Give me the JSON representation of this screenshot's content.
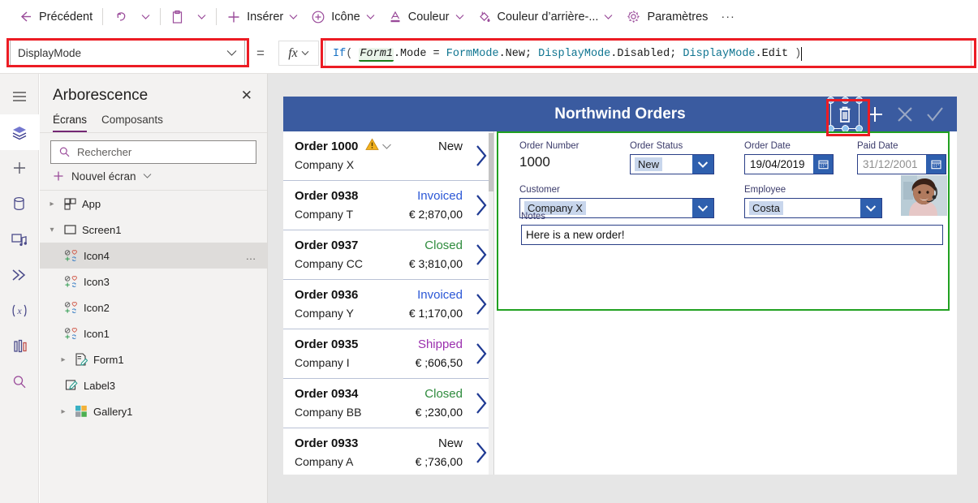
{
  "toolbar": {
    "back": {
      "label": "Précédent",
      "icon": "arrow-left-icon"
    },
    "undo": {
      "icon": "undo-icon"
    },
    "undo_caret": {
      "icon": "chevron-down-icon"
    },
    "paste": {
      "icon": "clipboard-icon"
    },
    "paste_caret": {
      "icon": "chevron-down-icon"
    },
    "insert": {
      "label": "Insérer",
      "icon": "plus-icon"
    },
    "icon_menu": {
      "label": "Icône",
      "icon": "circle-plus-icon"
    },
    "color": {
      "label": "Couleur",
      "icon": "font-color-icon"
    },
    "fill": {
      "label": "Couleur d’arrière-...",
      "icon": "fill-bucket-icon"
    },
    "settings": {
      "label": "Paramètres",
      "icon": "gear-icon"
    },
    "overflow": {
      "label": "···"
    }
  },
  "property_bar": {
    "selected_property": "DisplayMode",
    "equals": "=",
    "fx_label": "fx",
    "formula_tokens": [
      {
        "t": "If",
        "k": "fn"
      },
      {
        "t": "(",
        "k": "paren"
      },
      {
        "t": " ",
        "k": "plain"
      },
      {
        "t": "Form1",
        "k": "idbox"
      },
      {
        "t": ".Mode = ",
        "k": "plain"
      },
      {
        "t": "FormMode",
        "k": "enum"
      },
      {
        "t": ".New; ",
        "k": "plain"
      },
      {
        "t": "DisplayMode",
        "k": "enum"
      },
      {
        "t": ".Disabled; ",
        "k": "plain"
      },
      {
        "t": "DisplayMode",
        "k": "enum"
      },
      {
        "t": ".Edit ",
        "k": "plain"
      },
      {
        "t": ")",
        "k": "paren"
      }
    ],
    "formula_text": "If( Form1.Mode = FormMode.New; DisplayMode.Disabled; DisplayMode.Edit )"
  },
  "rail": {
    "items": [
      {
        "name": "hamburger-menu-icon",
        "active": false
      },
      {
        "name": "tree-view-icon",
        "active": true
      },
      {
        "name": "insert-icon",
        "active": false
      },
      {
        "name": "data-icon",
        "active": false
      },
      {
        "name": "media-icon",
        "active": false
      },
      {
        "name": "power-automate-icon",
        "active": false
      },
      {
        "name": "variables-icon",
        "active": false
      },
      {
        "name": "app-checker-icon",
        "active": false
      },
      {
        "name": "search-icon",
        "active": false
      }
    ]
  },
  "tree_panel": {
    "title": "Arborescence",
    "close_label": "✕",
    "tabs": [
      {
        "label": "Écrans",
        "selected": true
      },
      {
        "label": "Composants",
        "selected": false
      }
    ],
    "search_placeholder": "Rechercher",
    "new_screen_label": "Nouvel écran",
    "nodes": [
      {
        "label": "App",
        "icon": "app-icon",
        "indent": 1,
        "twisty": "collapsed",
        "selected": false,
        "dots": false
      },
      {
        "label": "Screen1",
        "icon": "screen-icon",
        "indent": 1,
        "twisty": "expanded",
        "selected": false,
        "dots": false
      },
      {
        "label": "Icon4",
        "icon": "icon-control-icon",
        "indent": 2,
        "twisty": "none",
        "selected": true,
        "dots": true
      },
      {
        "label": "Icon3",
        "icon": "icon-control-icon",
        "indent": 2,
        "twisty": "none",
        "selected": false,
        "dots": false
      },
      {
        "label": "Icon2",
        "icon": "icon-control-icon",
        "indent": 2,
        "twisty": "none",
        "selected": false,
        "dots": false
      },
      {
        "label": "Icon1",
        "icon": "icon-control-icon",
        "indent": 2,
        "twisty": "none",
        "selected": false,
        "dots": false
      },
      {
        "label": "Form1",
        "icon": "form-icon",
        "indent": 1,
        "twisty": "collapsed",
        "selected": false,
        "dots": false
      },
      {
        "label": "Label3",
        "icon": "label-icon",
        "indent": 2,
        "twisty": "none",
        "selected": false,
        "dots": false
      },
      {
        "label": "Gallery1",
        "icon": "gallery-icon",
        "indent": 1,
        "twisty": "collapsed",
        "selected": false,
        "dots": false
      }
    ]
  },
  "app_preview": {
    "header": {
      "title": "Northwind Orders",
      "bg_color": "#3a5ba0",
      "icons": [
        {
          "name": "trash-icon",
          "state": "selected"
        },
        {
          "name": "plus-icon",
          "state": "enabled"
        },
        {
          "name": "cancel-x-icon",
          "state": "disabled"
        },
        {
          "name": "check-icon",
          "state": "disabled"
        }
      ]
    },
    "gallery": {
      "rows": [
        {
          "order": "Order 1000",
          "company": "Company X",
          "status": "New",
          "status_color": "#1a1a1a",
          "amount": "",
          "warning": true
        },
        {
          "order": "Order 0938",
          "company": "Company T",
          "status": "Invoiced",
          "status_color": "#2b57d6",
          "amount": "€ 2;870,00",
          "warning": false
        },
        {
          "order": "Order 0937",
          "company": "Company CC",
          "status": "Closed",
          "status_color": "#2e8b3d",
          "amount": "€ 3;810,00",
          "warning": false
        },
        {
          "order": "Order 0936",
          "company": "Company Y",
          "status": "Invoiced",
          "status_color": "#2b57d6",
          "amount": "€ 1;170,00",
          "warning": false
        },
        {
          "order": "Order 0935",
          "company": "Company I",
          "status": "Shipped",
          "status_color": "#9b2fae",
          "amount": "€ ;606,50",
          "warning": false
        },
        {
          "order": "Order 0934",
          "company": "Company BB",
          "status": "Closed",
          "status_color": "#2e8b3d",
          "amount": "€ ;230,00",
          "warning": false
        },
        {
          "order": "Order 0933",
          "company": "Company A",
          "status": "New",
          "status_color": "#1a1a1a",
          "amount": "€ ;736,00",
          "warning": false
        }
      ]
    },
    "form": {
      "fields": {
        "order_number": {
          "label": "Order Number",
          "value": "1000"
        },
        "order_status": {
          "label": "Order Status",
          "value": "New"
        },
        "order_date": {
          "label": "Order Date",
          "value": "19/04/2019"
        },
        "paid_date": {
          "label": "Paid Date",
          "value": "31/12/2001"
        },
        "customer": {
          "label": "Customer",
          "value": "Company X"
        },
        "employee": {
          "label": "Employee",
          "value": "Costa"
        },
        "notes": {
          "label": "Notes",
          "value": "Here is a new order!"
        }
      },
      "selection_color": "#21a121"
    }
  },
  "annotations": {
    "boxes": [
      {
        "name": "property-selector-highlight"
      },
      {
        "name": "formula-bar-highlight"
      },
      {
        "name": "trash-icon-highlight"
      }
    ],
    "color": "#ec1c24"
  }
}
